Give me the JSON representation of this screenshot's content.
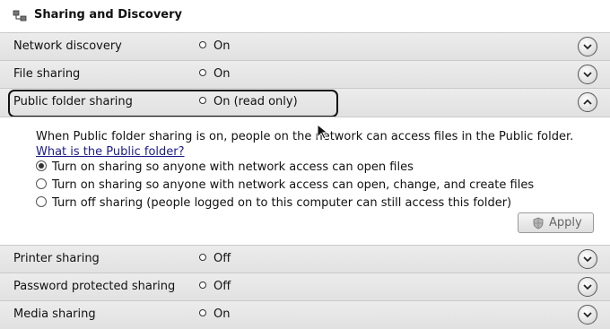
{
  "section": {
    "title": "Sharing and Discovery",
    "icon": "network-sharing-icon"
  },
  "rows": [
    {
      "label": "Network discovery",
      "status": "On"
    },
    {
      "label": "File sharing",
      "status": "On"
    },
    {
      "label": "Public folder sharing",
      "status": "On (read only)"
    },
    {
      "label": "Printer sharing",
      "status": "Off"
    },
    {
      "label": "Password protected sharing",
      "status": "Off"
    },
    {
      "label": "Media sharing",
      "status": "On"
    }
  ],
  "expanded_panel": {
    "description": "When Public folder sharing is on, people on the network can access files in the Public folder.",
    "link_text": "What is the Public folder?",
    "options": [
      {
        "label": "Turn on sharing so anyone with network access can open files",
        "checked": true
      },
      {
        "label": "Turn on sharing so anyone with network access can open, change, and create files",
        "checked": false
      },
      {
        "label": "Turn off sharing (people logged on to this computer can still access this folder)",
        "checked": false
      }
    ],
    "apply_label": "Apply"
  }
}
